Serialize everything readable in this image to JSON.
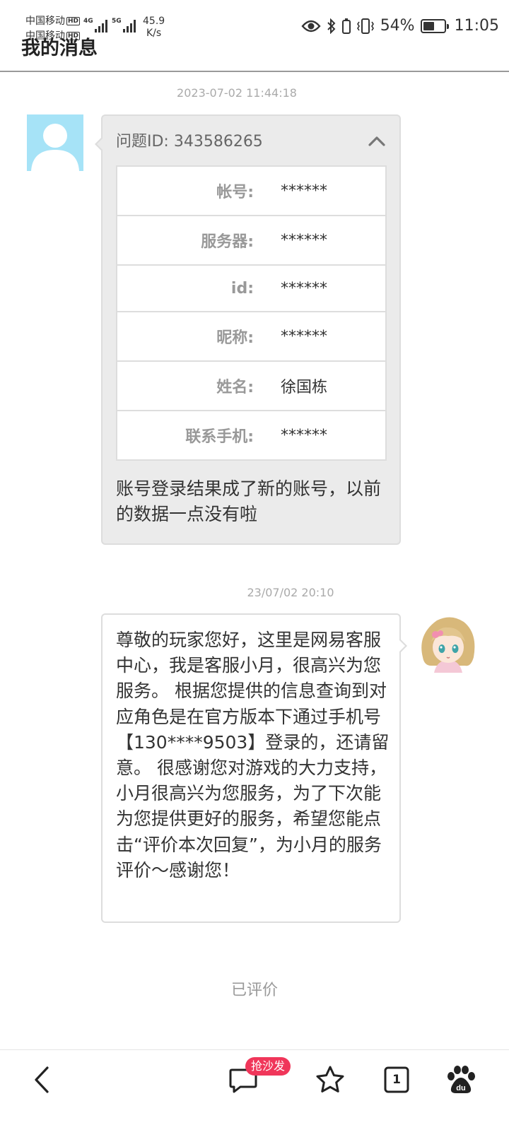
{
  "status_bar": {
    "carrier1": "中国移动",
    "carrier2": "中国移动",
    "hd_badge": "HD",
    "net_type1": "4G",
    "net_type2": "5G",
    "net_speed_value": "45.9",
    "net_speed_unit": "K/s",
    "battery_percent": "54%",
    "battery_level": 0.54,
    "time": "11:05",
    "icons": [
      "eye-icon",
      "bluetooth-icon",
      "vibrate-icon",
      "battery-icon"
    ]
  },
  "header": {
    "title": "我的消息"
  },
  "thread": {
    "ticket_timestamp": "2023-07-02 11:44:18",
    "ticket_title": "问题ID: 343586265",
    "ticket_fields": [
      {
        "label": "帐号:",
        "value": "******"
      },
      {
        "label": "服务器:",
        "value": "******"
      },
      {
        "label": "id:",
        "value": "******"
      },
      {
        "label": "昵称:",
        "value": "******"
      },
      {
        "label": "姓名:",
        "value": "徐国栋"
      },
      {
        "label": "联系手机:",
        "value": "******"
      }
    ],
    "ticket_message": "账号登录结果成了新的账号，以前的数据一点没有啦",
    "reply_timestamp": "23/07/02 20:10",
    "reply_message": "尊敬的玩家您好，这里是网易客服中心，我是客服小月，很高兴为您服务。 根据您提供的信息查询到对应角色是在官方版本下通过手机号【130****9503】登录的，还请留意。 很感谢您对游戏的大力支持，小月很高兴为您服务，为了下次能为您提供更好的服务，希望您能点击“评价本次回复”，为小月的服务评价～感谢您！",
    "rated_label": "已评价"
  },
  "bottom_bar": {
    "comment_badge": "抢沙发",
    "tab_count": "1",
    "icons": [
      "back-icon",
      "comment-icon",
      "star-icon",
      "tabs-icon",
      "baidu-paw-icon"
    ]
  },
  "colors": {
    "user_avatar_bg": "#a6e3f7",
    "badge": "#f0365a",
    "bubble_in_bg": "#ebebeb"
  }
}
